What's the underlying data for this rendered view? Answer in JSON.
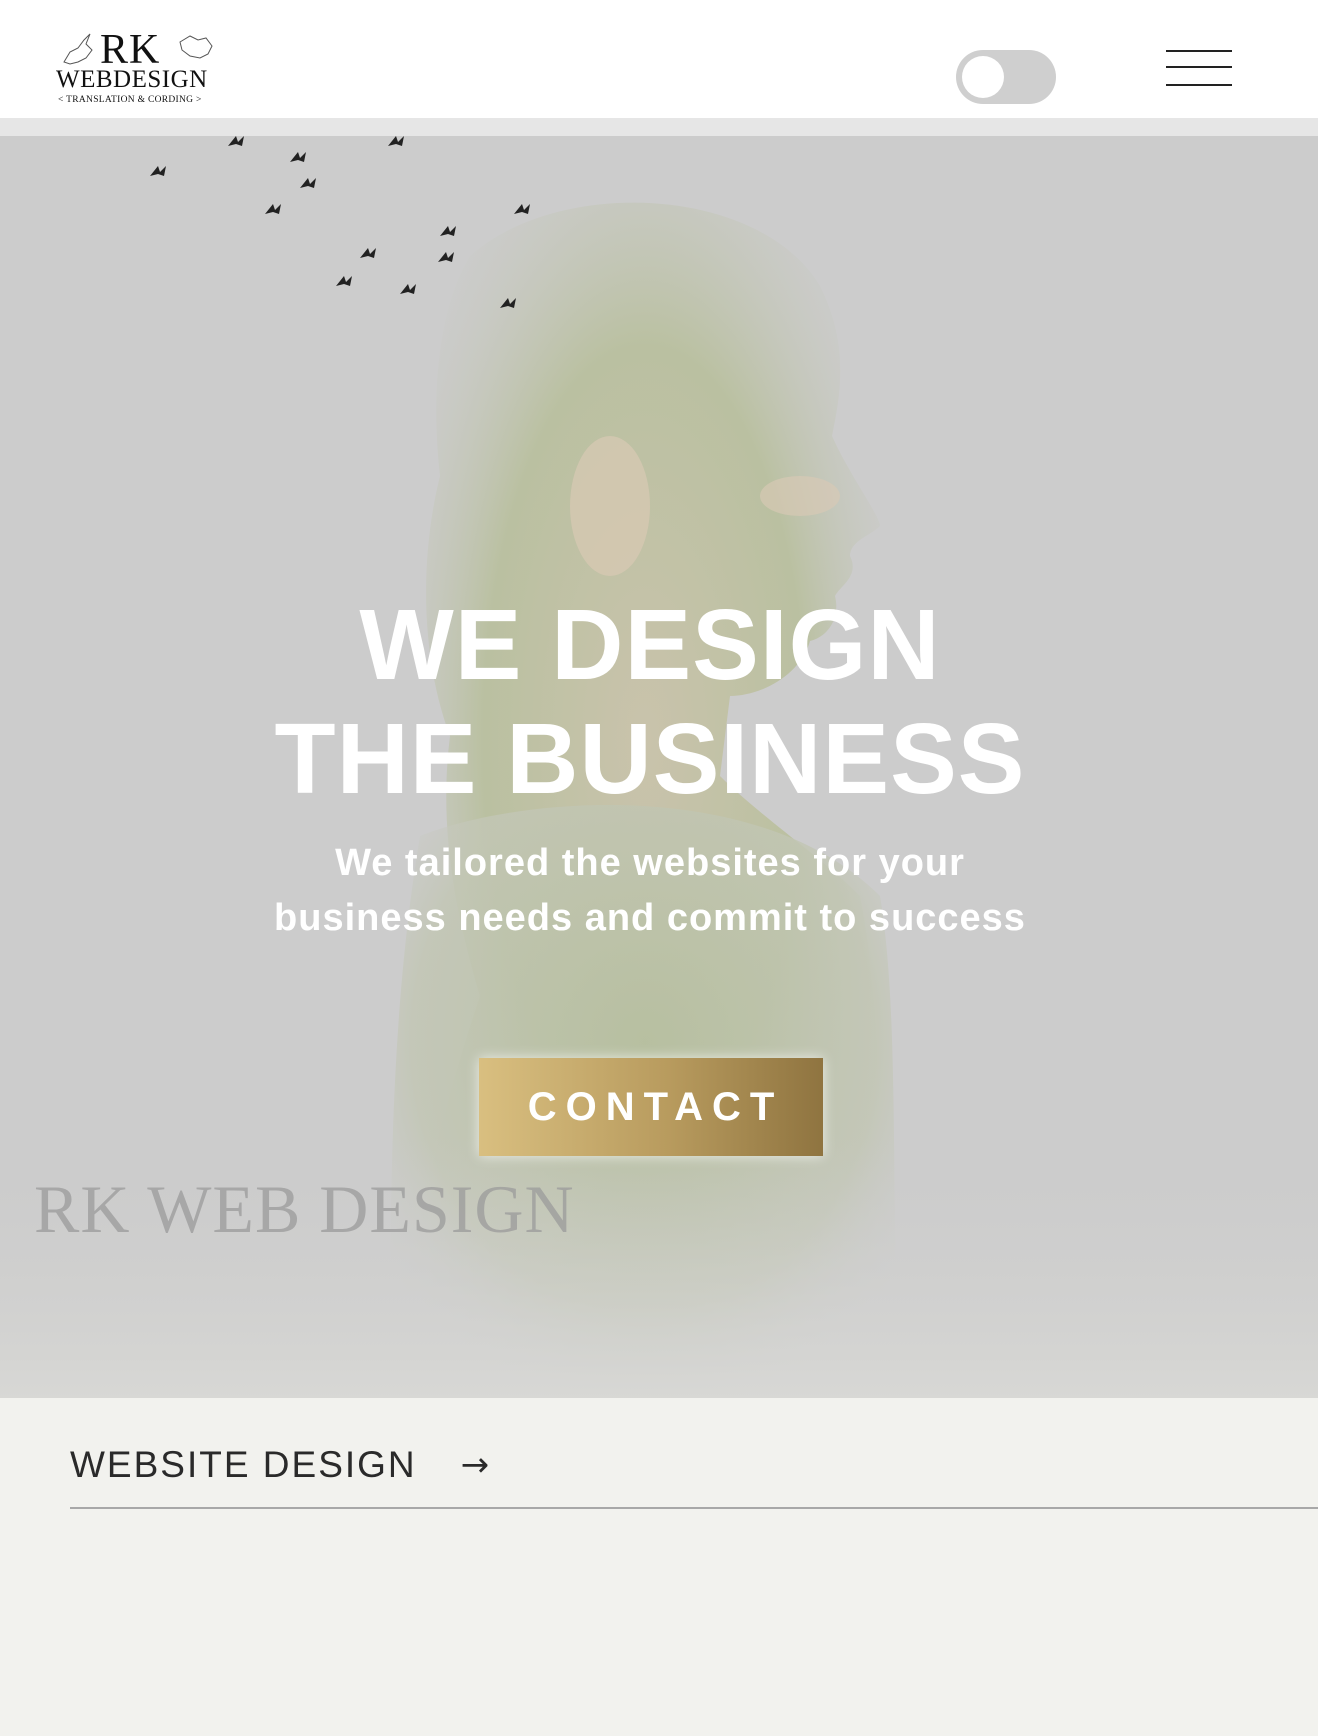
{
  "header": {
    "logo": {
      "line1": "RK",
      "line2": "WEBDESIGN",
      "tagline": "< TRANSLATION & CORDING >"
    },
    "theme_toggle": {
      "state": "off"
    },
    "menu": {
      "icon": "hamburger-menu-icon"
    }
  },
  "hero": {
    "title_line1": "WE DESIGN",
    "title_line2": "THE BUSINESS",
    "subtitle_line1": "We tailored the websites for your",
    "subtitle_line2": "business needs and commit to success",
    "cta_label": "CONTACT",
    "watermark": "RK WEB DESIGN",
    "background_color": "#cccccc",
    "cta_color": "#b89b5e"
  },
  "services": {
    "items": [
      {
        "label": "WEBSITE DESIGN",
        "icon": "arrow-right-icon"
      }
    ]
  }
}
